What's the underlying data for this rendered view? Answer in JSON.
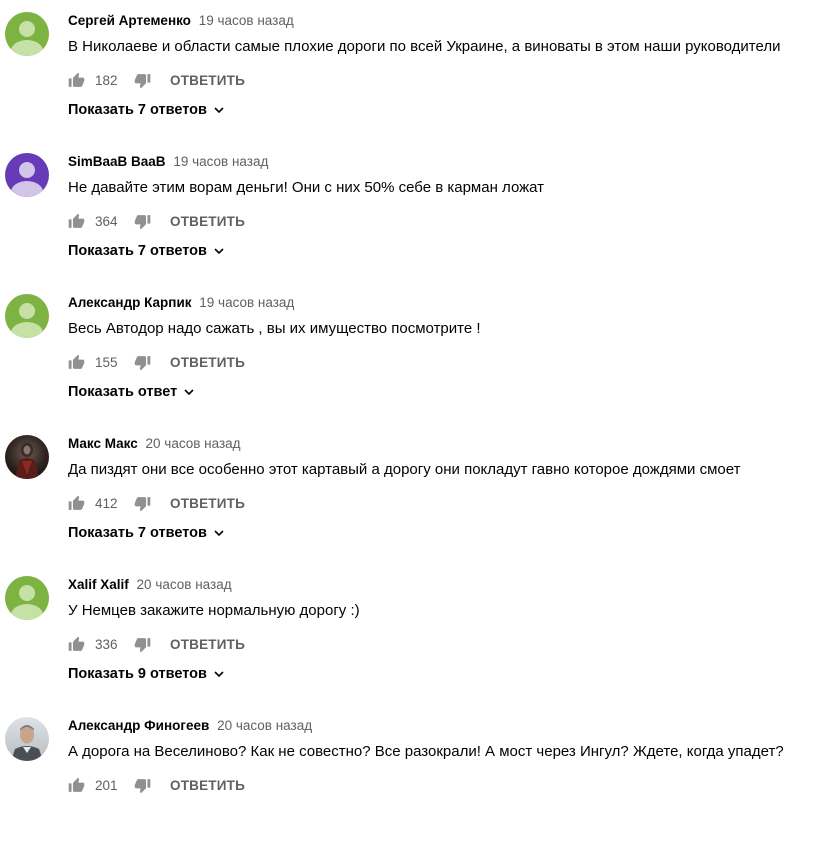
{
  "comments": [
    {
      "author": "Сергей Артеменко",
      "time": "19 часов назад",
      "text": "В Николаеве и области самые плохие дороги по всей Украине, а виноваты в этом наши руководители",
      "likes": "182",
      "reply_label": "ОТВЕТИТЬ",
      "replies_label": "Показать 7 ответов",
      "avatar": "default-green"
    },
    {
      "author": "SimBaaB BaaB",
      "time": "19 часов назад",
      "text": "Не давайте этим ворам деньги! Они с них 50% себе в карман ложат",
      "likes": "364",
      "reply_label": "ОТВЕТИТЬ",
      "replies_label": "Показать 7 ответов",
      "avatar": "default-purple"
    },
    {
      "author": "Александр Карпик",
      "time": "19 часов назад",
      "text": "Весь Автодор надо сажать , вы их имущество посмотрите !",
      "likes": "155",
      "reply_label": "ОТВЕТИТЬ",
      "replies_label": "Показать ответ",
      "avatar": "default-green"
    },
    {
      "author": "Макс Макс",
      "time": "20 часов назад",
      "text": "Да пиздят они все особенно этот картавый а дорогу они покладут гавно которое дождями смоет",
      "likes": "412",
      "reply_label": "ОТВЕТИТЬ",
      "replies_label": "Показать 7 ответов",
      "avatar": "photo-dark"
    },
    {
      "author": "Xalif Xalif",
      "time": "20 часов назад",
      "text": "У Немцев закажите нормальную дорогу :)",
      "likes": "336",
      "reply_label": "ОТВЕТИТЬ",
      "replies_label": "Показать 9 ответов",
      "avatar": "default-green"
    },
    {
      "author": "Александр Финогеев",
      "time": "20 часов назад",
      "text": "А дорога на Веселиново? Как не совестно? Все разокрали! А мост через Ингул? Ждете, когда упадет?",
      "likes": "201",
      "reply_label": "ОТВЕТИТЬ",
      "replies_label": "",
      "avatar": "photo-light"
    }
  ],
  "colors": {
    "avatar_green": "#7cb342",
    "avatar_purple": "#673ab7",
    "avatar_figure": "#c5e1a5",
    "avatar_figure_purple": "#d1c4e9",
    "icon_gray": "#909090",
    "meta_gray": "#606060",
    "text": "#030303"
  }
}
